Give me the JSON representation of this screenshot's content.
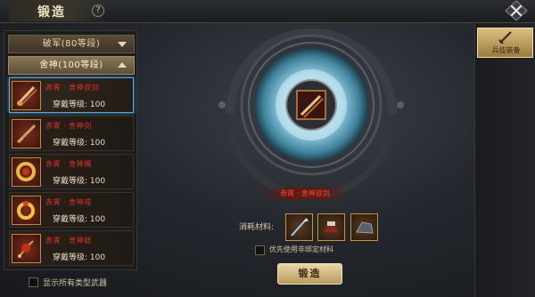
{
  "window": {
    "title": "锻造",
    "help": "?"
  },
  "categories": [
    {
      "label": "破军(80等段)",
      "expanded": false
    },
    {
      "label": "舍神(100等段)",
      "expanded": true
    }
  ],
  "weapons": [
    {
      "name": "赤霄 · 舍神双剑",
      "level": "穿戴等级: 100",
      "selected": true
    },
    {
      "name": "赤霄 · 舍神剑",
      "level": "穿戴等级: 100",
      "selected": false
    },
    {
      "name": "赤霄 · 舍神镯",
      "level": "穿戴等级: 100",
      "selected": false
    },
    {
      "name": "赤霄 · 舍神戒",
      "level": "穿戴等级: 100",
      "selected": false
    },
    {
      "name": "赤霄 · 舍神链",
      "level": "穿戴等级: 100",
      "selected": false
    }
  ],
  "show_all": {
    "label": "显示所有类型武器",
    "checked": false
  },
  "forge": {
    "selected_weapon": "赤霄 · 舍神双剑",
    "materials_label": "消耗材料:",
    "materials": [
      {
        "icon": "spear-material-icon"
      },
      {
        "icon": "armor-material-icon"
      },
      {
        "icon": "ore-material-icon"
      }
    ],
    "prefer_label": "优先使用非绑定材料",
    "button": "锻造"
  },
  "right_tab": {
    "label": "兵技装备"
  },
  "colors": {
    "accent": "#c8a35a",
    "weapon_name": "#e0322a",
    "selected_border": "#5ea8d6"
  }
}
